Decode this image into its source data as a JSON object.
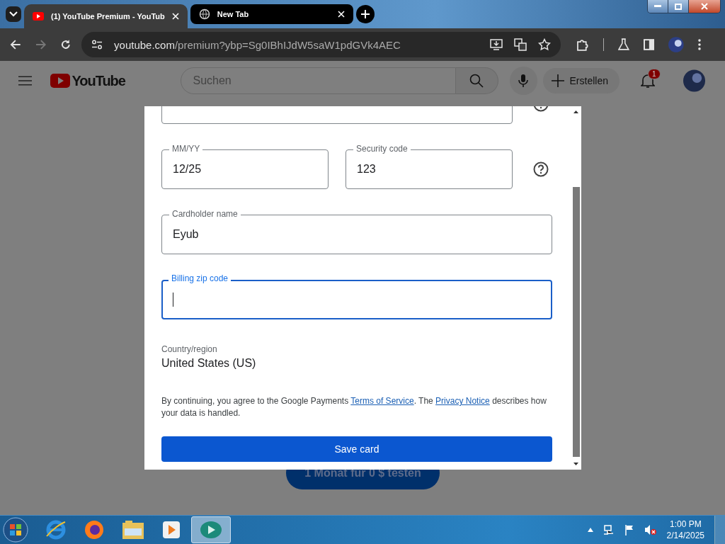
{
  "browser": {
    "tabs": [
      {
        "title": "(1) YouTube Premium - YouTub",
        "selected": true
      },
      {
        "title": "New Tab",
        "selected": false
      }
    ],
    "address": {
      "host": "youtube.com",
      "path": "/premium?ybp=Sg0IBhIJdW5saW1pdGVk4AEC"
    }
  },
  "youtube_header": {
    "logo": "YouTube",
    "search": {
      "placeholder": "Suchen"
    },
    "create": "Erstellen",
    "notifications": "1"
  },
  "page": {
    "cta": "1 Monat für 0 $ testen"
  },
  "dialog": {
    "rows": [
      {
        "help": true,
        "fields": [
          {
            "focused": false
          }
        ]
      },
      {
        "help": true,
        "fields": [
          {
            "label": "MM/YY",
            "value": "12/25",
            "focused": false
          },
          {
            "label": "Security code",
            "value": "123",
            "focused": false
          }
        ]
      },
      {
        "help": false,
        "fields": [
          {
            "label": "Cardholder name",
            "value": "Eyub",
            "focused": false
          }
        ]
      },
      {
        "help": false,
        "fields": [
          {
            "label": "Billing zip code",
            "focused": true
          }
        ]
      }
    ],
    "country_label": "Country/region",
    "country": "United States (US)",
    "notice": [
      {
        "kind": "text",
        "text": "By continuing, you agree to the Google Payments "
      },
      {
        "kind": "link",
        "text": "Terms of Service"
      },
      {
        "kind": "text",
        "text": ". The "
      },
      {
        "kind": "link",
        "text": "Privacy Notice"
      },
      {
        "kind": "text",
        "text": " describes how your data is handled."
      }
    ],
    "save": "Save card"
  },
  "taskbar": {
    "time": "1:00 PM",
    "date": "2/14/2025"
  }
}
